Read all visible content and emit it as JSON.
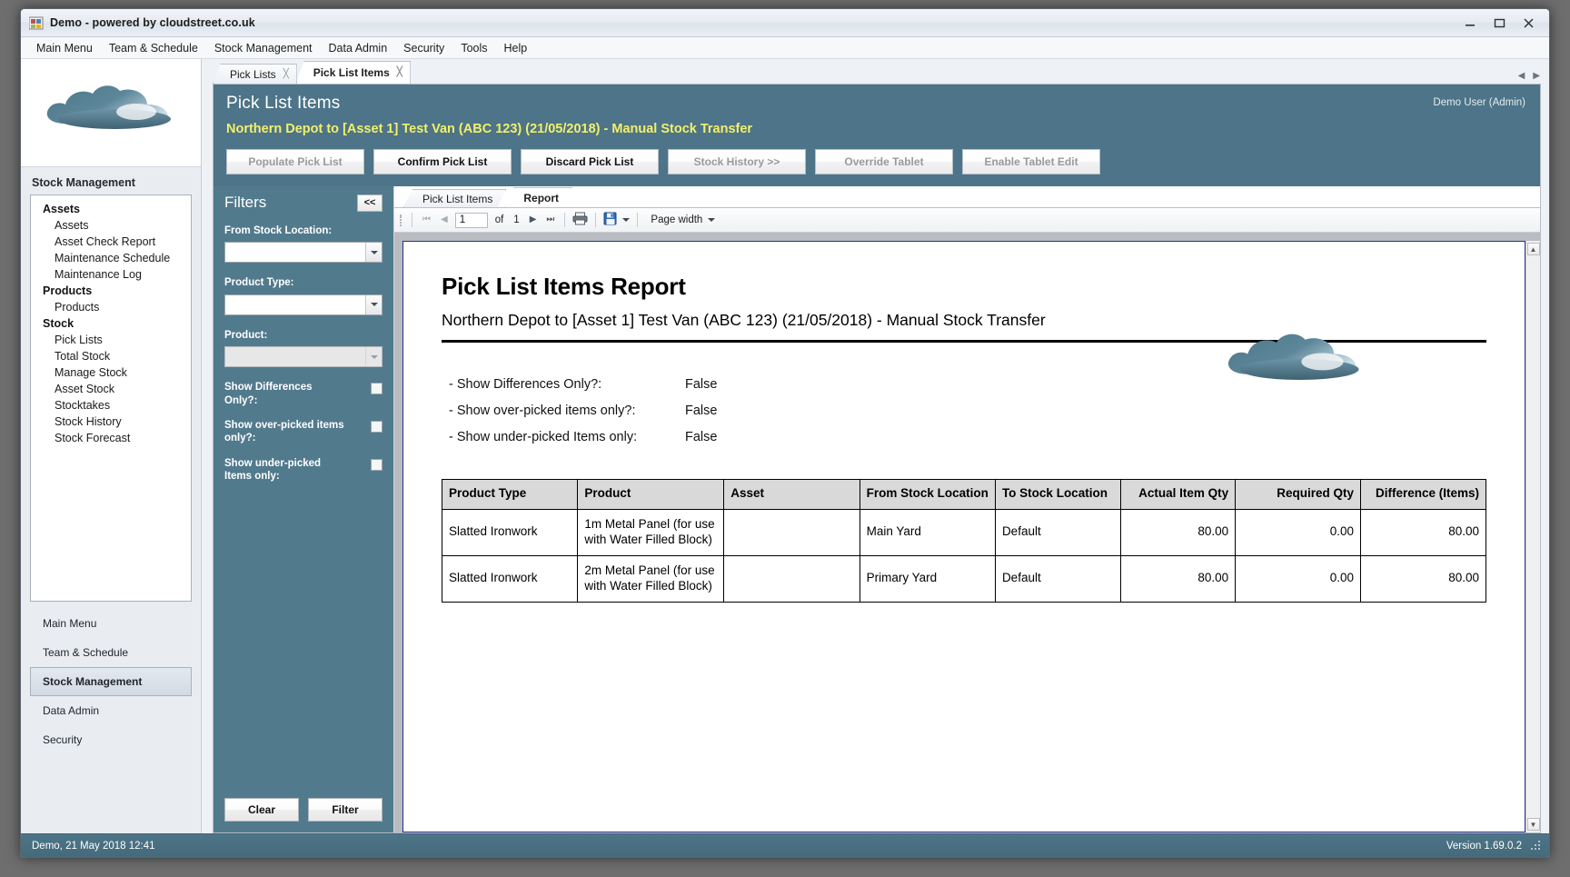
{
  "window": {
    "title": "Demo - powered by cloudstreet.co.uk",
    "minimize": "minimize-icon",
    "maximize": "maximize-icon",
    "close": "close-icon"
  },
  "menubar": {
    "items": [
      {
        "label": "Main Menu"
      },
      {
        "label": "Team & Schedule"
      },
      {
        "label": "Stock Management"
      },
      {
        "label": "Data Admin"
      },
      {
        "label": "Security"
      },
      {
        "label": "Tools"
      },
      {
        "label": "Help"
      }
    ]
  },
  "sidebar": {
    "section_title": "Stock Management",
    "groups": [
      {
        "label": "Assets",
        "items": [
          "Assets",
          "Asset Check Report",
          "Maintenance Schedule",
          "Maintenance Log"
        ]
      },
      {
        "label": "Products",
        "items": [
          "Products"
        ]
      },
      {
        "label": "Stock",
        "items": [
          "Pick Lists",
          "Total Stock",
          "Manage Stock",
          "Asset Stock",
          "Stocktakes",
          "Stock History",
          "Stock Forecast"
        ]
      }
    ],
    "footer": [
      {
        "label": "Main Menu",
        "active": false
      },
      {
        "label": "Team & Schedule",
        "active": false
      },
      {
        "label": "Stock Management",
        "active": true
      },
      {
        "label": "Data Admin",
        "active": false
      },
      {
        "label": "Security",
        "active": false
      }
    ]
  },
  "doctabs": [
    {
      "label": "Pick Lists",
      "active": false
    },
    {
      "label": "Pick List Items",
      "active": true
    }
  ],
  "page": {
    "title": "Pick List Items",
    "subtitle": "Northern Depot to [Asset 1] Test Van (ABC 123) (21/05/2018) - Manual Stock Transfer",
    "user": "Demo User (Admin)",
    "actions": [
      {
        "label": "Populate Pick List",
        "accel": "P",
        "disabled": true
      },
      {
        "label": "Confirm Pick List",
        "accel": "o",
        "disabled": false
      },
      {
        "label": "Discard Pick List",
        "accel": "D",
        "disabled": false
      },
      {
        "label": "Stock History >>",
        "accel": "",
        "disabled": true
      },
      {
        "label": "Override Tablet",
        "accel": "",
        "disabled": true
      },
      {
        "label": "Enable Tablet Edit",
        "accel": "",
        "disabled": true
      }
    ]
  },
  "filters": {
    "title": "Filters",
    "collapse_label": "<<",
    "fields": [
      {
        "label": "From Stock Location:",
        "value": "",
        "disabled": false
      },
      {
        "label": "Product Type:",
        "value": "",
        "disabled": false
      },
      {
        "label": "Product:",
        "value": "",
        "disabled": true
      }
    ],
    "checks": [
      {
        "label": "Show Differences Only?:",
        "checked": false
      },
      {
        "label": "Show over-picked items only?:",
        "checked": false
      },
      {
        "label": "Show under-picked Items only:",
        "checked": false
      }
    ],
    "buttons": [
      {
        "label": "Clear",
        "accel": "l"
      },
      {
        "label": "Filter",
        "accel": "F"
      }
    ]
  },
  "subtabs": [
    {
      "label": "Pick List Items",
      "active": false
    },
    {
      "label": "Report",
      "active": true
    }
  ],
  "report_toolbar": {
    "page_current": "1",
    "of_label": "of",
    "page_total": "1",
    "first_icon": "first-page-icon",
    "prev_icon": "previous-page-icon",
    "next_icon": "next-page-icon",
    "last_icon": "last-page-icon",
    "print_icon": "print-icon",
    "export_icon": "export-save-icon",
    "zoom_value": "Page width"
  },
  "report": {
    "title": "Pick List Items Report",
    "subtitle": "Northern Depot to [Asset 1] Test Van (ABC 123) (21/05/2018) - Manual Stock Transfer",
    "parameters": [
      {
        "name": "- Show Differences Only?:",
        "value": "False"
      },
      {
        "name": "- Show over-picked items only?:",
        "value": "False"
      },
      {
        "name": "- Show under-picked Items only:",
        "value": "False"
      }
    ],
    "table": {
      "columns": [
        "Product Type",
        "Product",
        "Asset",
        "From Stock Location",
        "To Stock Location",
        "Actual Item Qty",
        "Required Qty",
        "Difference (Items)"
      ],
      "rows": [
        {
          "product_type": "Slatted Ironwork",
          "product": "1m Metal Panel (for use with Water Filled Block)",
          "asset": "",
          "from_location": "Main Yard",
          "to_location": "Default",
          "actual_qty": "80.00",
          "required_qty": "0.00",
          "difference": "80.00"
        },
        {
          "product_type": "Slatted Ironwork",
          "product": "2m Metal Panel (for use with Water Filled Block)",
          "asset": "",
          "from_location": "Primary Yard",
          "to_location": "Default",
          "actual_qty": "80.00",
          "required_qty": "0.00",
          "difference": "80.00"
        }
      ]
    }
  },
  "statusbar": {
    "left": "Demo, 21 May 2018 12:41",
    "right": "Version 1.69.0.2"
  },
  "colors": {
    "header_teal": "#4d7488",
    "filter_teal": "#527a8d",
    "accent_yellow": "#f2f06a",
    "report_border": "#2a2f8f"
  }
}
